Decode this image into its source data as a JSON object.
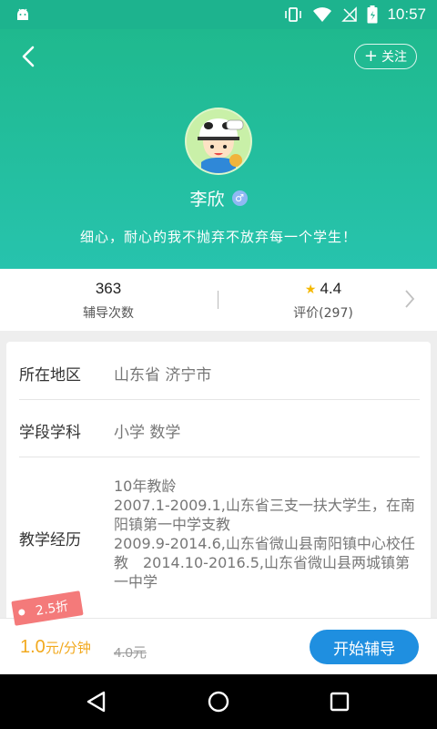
{
  "status_bar": {
    "time": "10:57"
  },
  "header": {
    "follow_label": "关注",
    "name": "李欣",
    "gender": "male",
    "motto": "细心，耐心的我不抛弃不放弃每一个学生！"
  },
  "stats": {
    "sessions_value": "363",
    "sessions_label": "辅导次数",
    "rating_value": "4.4",
    "rating_label": "评价(297)"
  },
  "profile": {
    "region_label": "所在地区",
    "region_value": "山东省 济宁市",
    "subject_label": "学段学科",
    "subject_value": "小学 数学",
    "experience_label": "教学经历",
    "experience_value": "10年教龄\n2007.1-2009.1,山东省三支一扶大学生，在南阳镇第一中学支教\n2009.9-2014.6,山东省微山县南阳镇中心校任教　2014.10-2016.5,山东省微山县两城镇第一中学"
  },
  "pricing": {
    "discount_tag": "2.5折",
    "price": "1.0",
    "unit": "元/分钟",
    "original_price": "4.0元",
    "start_button": "开始辅导"
  },
  "colors": {
    "header_top": "#1fb98e",
    "header_bottom": "#27c3ad",
    "accent_blue": "#1f8fe0",
    "price_orange": "#f2a91e",
    "discount_red": "#f47a7a"
  }
}
